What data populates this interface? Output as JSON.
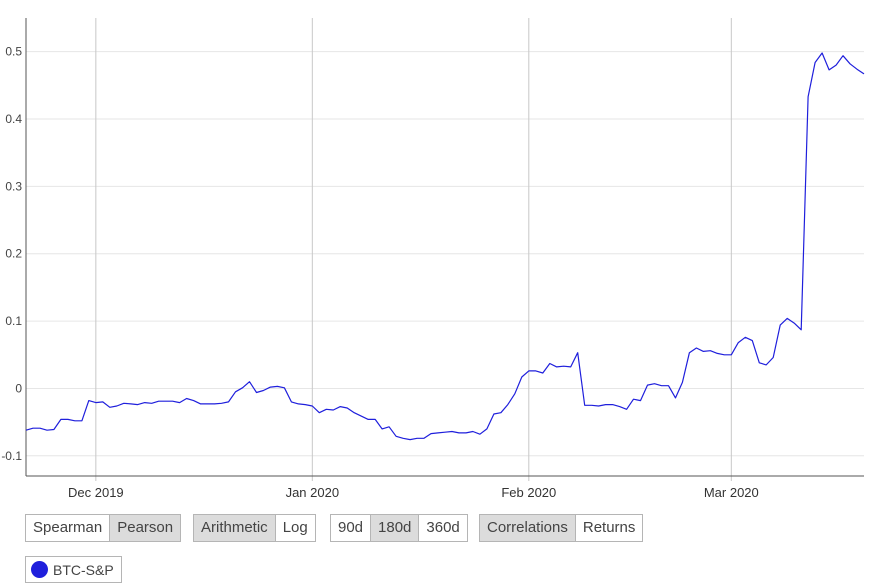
{
  "chart_data": {
    "type": "line",
    "title": "",
    "xlabel": "",
    "ylabel": "",
    "x_ticks": [
      "Dec 2019",
      "Jan 2020",
      "Feb 2020",
      "Mar 2020"
    ],
    "x_tick_dates": [
      "2019-12-01",
      "2020-01-01",
      "2020-02-01",
      "2020-03-01"
    ],
    "x_range": [
      "2019-11-21",
      "2020-03-20"
    ],
    "y_ticks": [
      -0.1,
      0,
      0.1,
      0.2,
      0.3,
      0.4,
      0.5
    ],
    "y_tick_labels": [
      "-0.1",
      "0",
      "0.1",
      "0.2",
      "0.3",
      "0.4",
      "0.5"
    ],
    "ylim": [
      -0.13,
      0.55
    ],
    "grid": true,
    "series": [
      {
        "name": "BTC-S&P",
        "color": "#1f1fdc",
        "points": [
          [
            "2019-11-21",
            -0.062
          ],
          [
            "2019-11-22",
            -0.059
          ],
          [
            "2019-11-23",
            -0.059
          ],
          [
            "2019-11-24",
            -0.062
          ],
          [
            "2019-11-25",
            -0.061
          ],
          [
            "2019-11-26",
            -0.046
          ],
          [
            "2019-11-27",
            -0.046
          ],
          [
            "2019-11-28",
            -0.048
          ],
          [
            "2019-11-29",
            -0.048
          ],
          [
            "2019-11-30",
            -0.018
          ],
          [
            "2019-12-01",
            -0.021
          ],
          [
            "2019-12-02",
            -0.02
          ],
          [
            "2019-12-03",
            -0.028
          ],
          [
            "2019-12-04",
            -0.026
          ],
          [
            "2019-12-05",
            -0.022
          ],
          [
            "2019-12-06",
            -0.023
          ],
          [
            "2019-12-07",
            -0.024
          ],
          [
            "2019-12-08",
            -0.021
          ],
          [
            "2019-12-09",
            -0.022
          ],
          [
            "2019-12-10",
            -0.019
          ],
          [
            "2019-12-11",
            -0.019
          ],
          [
            "2019-12-12",
            -0.019
          ],
          [
            "2019-12-13",
            -0.021
          ],
          [
            "2019-12-14",
            -0.015
          ],
          [
            "2019-12-15",
            -0.018
          ],
          [
            "2019-12-16",
            -0.023
          ],
          [
            "2019-12-17",
            -0.023
          ],
          [
            "2019-12-18",
            -0.023
          ],
          [
            "2019-12-19",
            -0.022
          ],
          [
            "2019-12-20",
            -0.02
          ],
          [
            "2019-12-21",
            -0.005
          ],
          [
            "2019-12-22",
            0.001
          ],
          [
            "2019-12-23",
            0.01
          ],
          [
            "2019-12-24",
            -0.006
          ],
          [
            "2019-12-25",
            -0.003
          ],
          [
            "2019-12-26",
            0.002
          ],
          [
            "2019-12-27",
            0.003
          ],
          [
            "2019-12-28",
            0.001
          ],
          [
            "2019-12-29",
            -0.02
          ],
          [
            "2019-12-30",
            -0.023
          ],
          [
            "2019-12-31",
            -0.024
          ],
          [
            "2020-01-01",
            -0.026
          ],
          [
            "2020-01-02",
            -0.036
          ],
          [
            "2020-01-03",
            -0.031
          ],
          [
            "2020-01-04",
            -0.032
          ],
          [
            "2020-01-05",
            -0.027
          ],
          [
            "2020-01-06",
            -0.029
          ],
          [
            "2020-01-07",
            -0.036
          ],
          [
            "2020-01-08",
            -0.041
          ],
          [
            "2020-01-09",
            -0.046
          ],
          [
            "2020-01-10",
            -0.046
          ],
          [
            "2020-01-11",
            -0.06
          ],
          [
            "2020-01-12",
            -0.057
          ],
          [
            "2020-01-13",
            -0.071
          ],
          [
            "2020-01-14",
            -0.074
          ],
          [
            "2020-01-15",
            -0.076
          ],
          [
            "2020-01-16",
            -0.074
          ],
          [
            "2020-01-17",
            -0.074
          ],
          [
            "2020-01-18",
            -0.067
          ],
          [
            "2020-01-19",
            -0.066
          ],
          [
            "2020-01-20",
            -0.065
          ],
          [
            "2020-01-21",
            -0.064
          ],
          [
            "2020-01-22",
            -0.066
          ],
          [
            "2020-01-23",
            -0.066
          ],
          [
            "2020-01-24",
            -0.064
          ],
          [
            "2020-01-25",
            -0.068
          ],
          [
            "2020-01-26",
            -0.06
          ],
          [
            "2020-01-27",
            -0.038
          ],
          [
            "2020-01-28",
            -0.036
          ],
          [
            "2020-01-29",
            -0.024
          ],
          [
            "2020-01-30",
            -0.008
          ],
          [
            "2020-01-31",
            0.017
          ],
          [
            "2020-02-01",
            0.026
          ],
          [
            "2020-02-02",
            0.026
          ],
          [
            "2020-02-03",
            0.023
          ],
          [
            "2020-02-04",
            0.037
          ],
          [
            "2020-02-05",
            0.032
          ],
          [
            "2020-02-06",
            0.033
          ],
          [
            "2020-02-07",
            0.032
          ],
          [
            "2020-02-08",
            0.053
          ],
          [
            "2020-02-09",
            -0.025
          ],
          [
            "2020-02-10",
            -0.025
          ],
          [
            "2020-02-11",
            -0.026
          ],
          [
            "2020-02-12",
            -0.024
          ],
          [
            "2020-02-13",
            -0.024
          ],
          [
            "2020-02-14",
            -0.027
          ],
          [
            "2020-02-15",
            -0.031
          ],
          [
            "2020-02-16",
            -0.016
          ],
          [
            "2020-02-17",
            -0.018
          ],
          [
            "2020-02-18",
            0.005
          ],
          [
            "2020-02-19",
            0.007
          ],
          [
            "2020-02-20",
            0.004
          ],
          [
            "2020-02-21",
            0.004
          ],
          [
            "2020-02-22",
            -0.014
          ],
          [
            "2020-02-23",
            0.009
          ],
          [
            "2020-02-24",
            0.053
          ],
          [
            "2020-02-25",
            0.06
          ],
          [
            "2020-02-26",
            0.055
          ],
          [
            "2020-02-27",
            0.056
          ],
          [
            "2020-02-28",
            0.052
          ],
          [
            "2020-02-29",
            0.05
          ],
          [
            "2020-03-01",
            0.05
          ],
          [
            "2020-03-02",
            0.068
          ],
          [
            "2020-03-03",
            0.076
          ],
          [
            "2020-03-04",
            0.071
          ],
          [
            "2020-03-05",
            0.038
          ],
          [
            "2020-03-06",
            0.035
          ],
          [
            "2020-03-07",
            0.046
          ],
          [
            "2020-03-08",
            0.094
          ],
          [
            "2020-03-09",
            0.104
          ],
          [
            "2020-03-10",
            0.097
          ],
          [
            "2020-03-11",
            0.087
          ],
          [
            "2020-03-12",
            0.433
          ],
          [
            "2020-03-13",
            0.484
          ],
          [
            "2020-03-14",
            0.498
          ],
          [
            "2020-03-15",
            0.473
          ],
          [
            "2020-03-16",
            0.48
          ],
          [
            "2020-03-17",
            0.494
          ],
          [
            "2020-03-18",
            0.482
          ],
          [
            "2020-03-19",
            0.474
          ],
          [
            "2020-03-20",
            0.467
          ]
        ]
      }
    ],
    "legend": {
      "placement": "bottom-left",
      "items": [
        {
          "label": "BTC-S&P",
          "color": "#1f1fdc"
        }
      ]
    }
  },
  "controls": {
    "method": [
      {
        "label": "Spearman",
        "active": false
      },
      {
        "label": "Pearson",
        "active": true
      }
    ],
    "scale": [
      {
        "label": "Arithmetic",
        "active": true
      },
      {
        "label": "Log",
        "active": false
      }
    ],
    "period": [
      {
        "label": "90d",
        "active": false
      },
      {
        "label": "180d",
        "active": true
      },
      {
        "label": "360d",
        "active": false
      }
    ],
    "view": [
      {
        "label": "Correlations",
        "active": true
      },
      {
        "label": "Returns",
        "active": false
      }
    ]
  },
  "colors": {
    "line": "#1f1fdc",
    "grid": "#e6e6e6",
    "vgrid": "#c8c8c8",
    "axis": "#555555",
    "active_button": "#dcdcdc"
  }
}
